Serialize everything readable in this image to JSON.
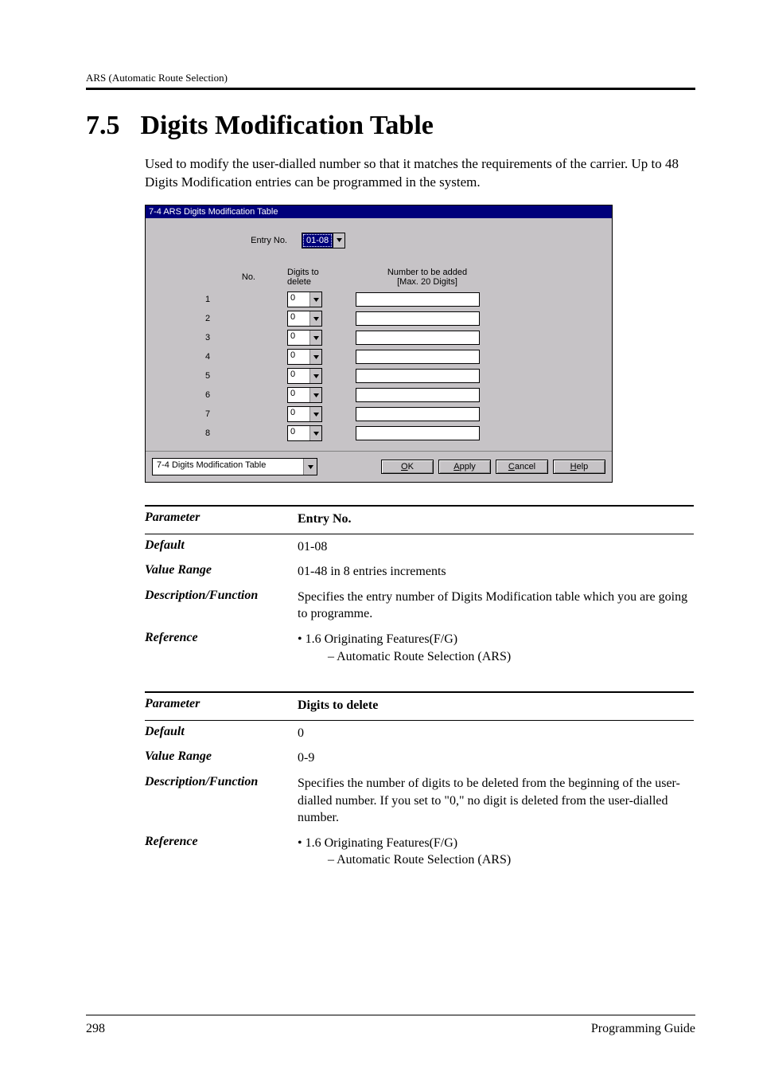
{
  "running_head": "ARS (Automatic Route Selection)",
  "chapter": {
    "num": "7.5",
    "title": "Digits Modification Table"
  },
  "intro": "Used to modify the user-dialled number so that it matches the requirements of the carrier. Up to 48 Digits Modification entries can be programmed in the system.",
  "dialog": {
    "title": "7-4 ARS Digits Modification Table",
    "entry_label": "Entry No.",
    "entry_value": "01-08",
    "headers": {
      "no": "No.",
      "digits": "Digits to\ndelete",
      "number": "Number to be added\n[Max. 20 Digits]"
    },
    "rows": [
      {
        "no": "1",
        "digits": "0",
        "num": ""
      },
      {
        "no": "2",
        "digits": "0",
        "num": ""
      },
      {
        "no": "3",
        "digits": "0",
        "num": ""
      },
      {
        "no": "4",
        "digits": "0",
        "num": ""
      },
      {
        "no": "5",
        "digits": "0",
        "num": ""
      },
      {
        "no": "6",
        "digits": "0",
        "num": ""
      },
      {
        "no": "7",
        "digits": "0",
        "num": ""
      },
      {
        "no": "8",
        "digits": "0",
        "num": ""
      }
    ],
    "footer_select": "7-4 Digits Modification Table",
    "buttons": {
      "ok": "OK",
      "apply": "Apply",
      "cancel": "Cancel",
      "help": "Help"
    }
  },
  "param1": {
    "header": "Entry No.",
    "default": "01-08",
    "range": "01-48 in 8 entries increments",
    "desc": "Specifies the entry number of Digits Modification table which you are going to programme.",
    "ref_line1": "• 1.6 Originating Features(F/G)",
    "ref_line2": "– Automatic Route Selection (ARS)"
  },
  "param2": {
    "header": "Digits to delete",
    "default": "0",
    "range": "0-9",
    "desc": "Specifies the number of digits to be deleted from the beginning of the user-dialled number. If you set to \"0,\" no digit is deleted from the user-dialled number.",
    "ref_line1": "• 1.6 Originating Features(F/G)",
    "ref_line2": "– Automatic Route Selection (ARS)"
  },
  "labels": {
    "parameter": "Parameter",
    "default": "Default",
    "value_range": "Value Range",
    "desc_func": "Description/Function",
    "reference": "Reference"
  },
  "footer": {
    "page": "298",
    "title": "Programming Guide"
  }
}
